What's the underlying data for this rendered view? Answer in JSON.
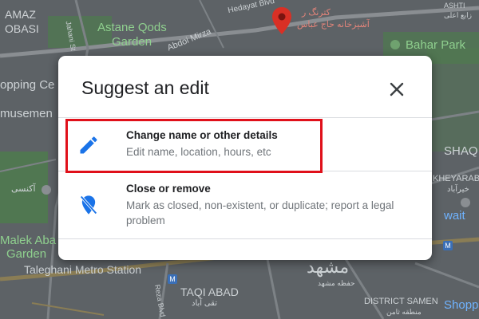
{
  "map": {
    "labels": {
      "amaz": "AMAZ",
      "obasi": "OBASI",
      "astane_qods": "Astane Qods",
      "garden": "Garden",
      "shopping_ce": "opping Ce",
      "amusemen": "musemen",
      "akhoondi": "آکنسی",
      "malek_aba": "Malek Aba",
      "malek_garden": "Garden",
      "taleghani": "Taleghani Metro Station",
      "taqi_abad": "TAQI ABAD",
      "taqi_abad_fa": "تقی آباد",
      "reza_blvd": "Reza Blvd",
      "hedayat_blvd": "Hedayat Blvd",
      "jahani": "Jahani St",
      "abdoi_mirza": "Abdoi Mirza",
      "bahar_park": "Bahar Park",
      "shaq": "SHAQ",
      "kheyaraba": "KHEYARABA",
      "kheyaraba_fa": "خیرآباد",
      "kuwait": "wait",
      "mashhad_fa": "مشهد",
      "mashhad_small_fa": "حفظه مشهد",
      "district_samen": "DISTRICT SAMEN",
      "district_samen_fa": "منطقه ثامن",
      "shop": "Shopp",
      "pin_label_1": "کترنگ ر",
      "pin_label_2": "آشپزخانه حاج عباس",
      "top_right_1": "ASHTI",
      "top_right_2": "زابع اعلی"
    },
    "colors": {
      "background": "#5d6266",
      "road": "#7d8286",
      "park": "#4f7a4f",
      "highway": "#8a7d55",
      "pin": "#d93025"
    }
  },
  "dialog": {
    "title": "Suggest an edit",
    "close_icon": "close-icon",
    "options": [
      {
        "icon": "pencil-icon",
        "title": "Change name or other details",
        "description": "Edit name, location, hours, etc",
        "highlighted": true
      },
      {
        "icon": "location-off-icon",
        "title": "Close or remove",
        "description": "Mark as closed, non-existent, or duplicate; report a legal problem",
        "highlighted": false
      }
    ],
    "colors": {
      "icon": "#1a73e8",
      "highlight_border": "#e0101a",
      "title": "#202124",
      "description": "#70757a"
    }
  }
}
